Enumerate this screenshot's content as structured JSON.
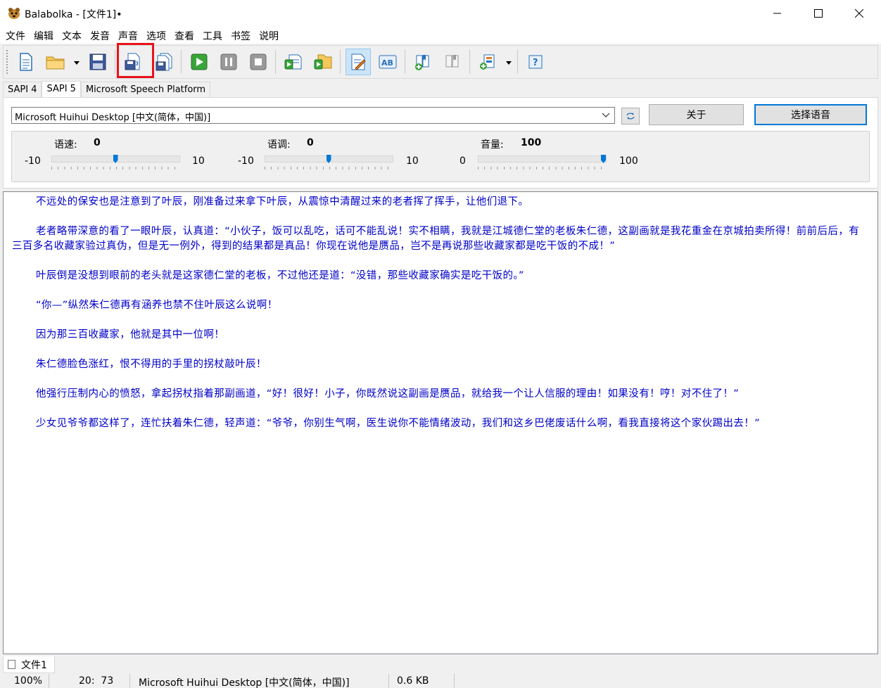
{
  "window": {
    "app_name": "Balabolka",
    "title": "Balabolka - [文件1]•"
  },
  "menu": [
    "文件",
    "编辑",
    "文本",
    "发音",
    "声音",
    "选项",
    "查看",
    "工具",
    "书签",
    "说明"
  ],
  "toolbar": {
    "buttons": [
      {
        "name": "new-document-icon"
      },
      {
        "name": "open-folder-icon"
      },
      {
        "name": "save-disk-icon"
      },
      {
        "name": "save-audio-file-icon",
        "highlighted": true
      },
      {
        "name": "batch-convert-icon"
      },
      {
        "name": "play-icon"
      },
      {
        "name": "pause-icon"
      },
      {
        "name": "stop-icon"
      },
      {
        "name": "read-clipboard-icon"
      },
      {
        "name": "read-files-icon"
      },
      {
        "name": "edit-text-icon",
        "active": true
      },
      {
        "name": "spell-check-icon"
      },
      {
        "name": "add-bookmark-icon"
      },
      {
        "name": "bookmarks-icon"
      },
      {
        "name": "pronunciation-dictionary-icon"
      },
      {
        "name": "help-icon"
      }
    ],
    "highlight_color": "#e8121b"
  },
  "tabs": [
    "SAPI 4",
    "SAPI 5",
    "Microsoft Speech Platform"
  ],
  "active_tab": "SAPI 5",
  "voice": {
    "selected": "Microsoft Huihui Desktop [中文(简体，中国)]",
    "about_label": "关于",
    "select_label": "选择语音"
  },
  "sliders": {
    "rate": {
      "label": "语速:",
      "value": "0",
      "min": "-10",
      "max": "10",
      "level": 0.5
    },
    "pitch": {
      "label": "语调:",
      "value": "0",
      "min": "-10",
      "max": "10",
      "level": 0.5
    },
    "volume": {
      "label": "音量:",
      "value": "100",
      "min": "0",
      "max": "100",
      "level": 1.0
    }
  },
  "text": {
    "color": "#0000c8",
    "paragraphs": [
      "不远处的保安也是注意到了叶辰，刚准备过来拿下叶辰，从震惊中清醒过来的老者挥了挥手，让他们退下。",
      "老者略带深意的看了一眼叶辰，认真道：“小伙子，饭可以乱吃，话可不能乱说！实不相瞒，我就是江城德仁堂的老板朱仁德，这副画就是我花重金在京城拍卖所得！前前后后，有三百多名收藏家验过真伪，但是无一例外，得到的结果都是真品！你现在说他是赝品，岂不是再说那些收藏家都是吃干饭的不成！”",
      "叶辰倒是没想到眼前的老头就是这家德仁堂的老板，不过他还是道：“没错，那些收藏家确实是吃干饭的。”",
      "“你—”纵然朱仁德再有涵养也禁不住叶辰这么说啊！",
      "因为那三百收藏家，他就是其中一位啊！",
      "朱仁德脸色涨红，恨不得用的手里的拐杖敲叶辰！",
      "他强行压制内心的愤怒，拿起拐杖指着那副画道，“好！很好！小子，你既然说这副画是赝品，就给我一个让人信服的理由！如果没有！哼！对不住了！”",
      "少女见爷爷都这样了，连忙扶着朱仁德，轻声道：“爷爷，你别生气啊，医生说你不能情绪波动，我们和这乡巴佬废话什么啊，看我直接将这个家伙踢出去！”"
    ]
  },
  "doc_tab": "文件1",
  "status": {
    "zoom": "100%",
    "position": "20:  73",
    "voice": "Microsoft Huihui Desktop [中文(简体，中国)]",
    "size": "0.6 KB"
  }
}
